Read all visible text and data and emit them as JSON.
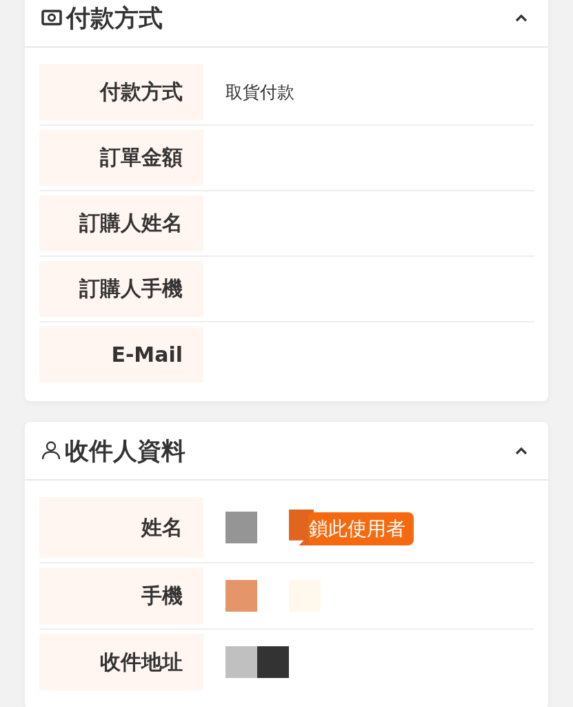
{
  "cards": [
    {
      "title": "付款方式",
      "kind": "payment",
      "expanded": true,
      "rows": [
        {
          "label": "付款方式",
          "value": "取貨付款"
        },
        {
          "label": "訂單金額"
        },
        {
          "label": "訂購人姓名"
        },
        {
          "label": "訂購人手機"
        },
        {
          "label": "E-Mail"
        }
      ]
    },
    {
      "title": "收件人資料",
      "kind": "recipient",
      "expanded": true,
      "rows": [
        {
          "label": "姓名",
          "mosaic": [
            {
              "kind": "tile",
              "color": "#959595"
            },
            {
              "kind": "blank"
            }
          ],
          "badge": "鎖此使用者"
        },
        {
          "label": "手機",
          "mosaic": [
            {
              "kind": "tile",
              "color": "#e5956a"
            },
            {
              "kind": "blank"
            },
            {
              "kind": "tile",
              "color": "#fff8ec"
            }
          ]
        },
        {
          "label": "收件地址",
          "mosaic": [
            {
              "kind": "tile",
              "color": "#c0c0c0"
            },
            {
              "kind": "tile",
              "color": "#333333"
            }
          ]
        }
      ]
    }
  ]
}
